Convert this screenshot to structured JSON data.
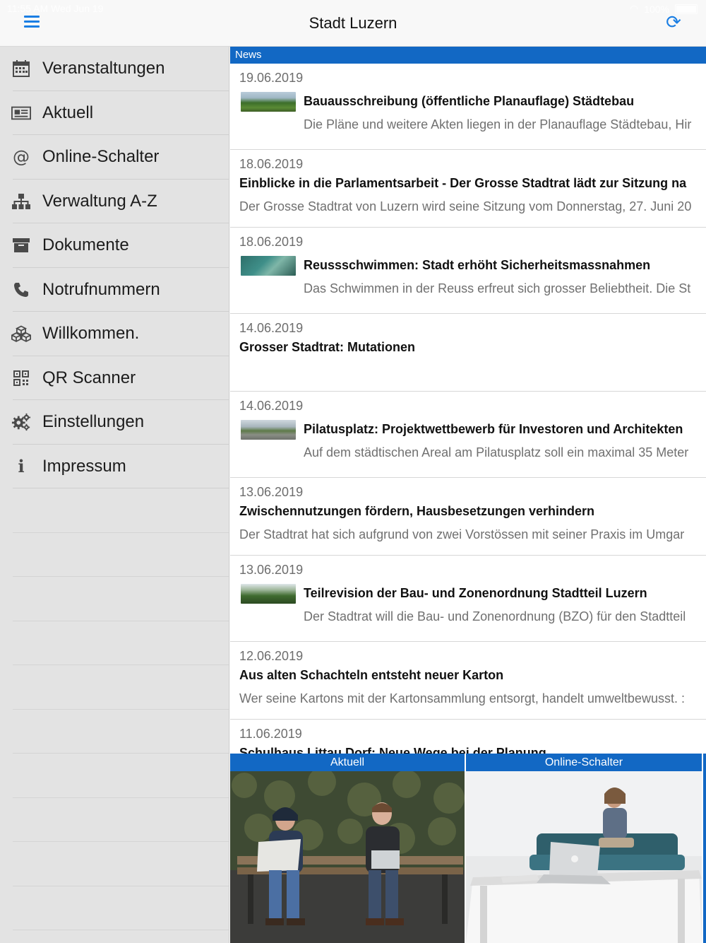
{
  "status_bar": {
    "time": "11:55 AM",
    "date": "Wed Jun 19",
    "battery": "100%"
  },
  "header": {
    "title": "Stadt Luzern"
  },
  "sidebar": {
    "items": [
      {
        "label": "Veranstaltungen",
        "icon": "calendar-icon"
      },
      {
        "label": "Aktuell",
        "icon": "newspaper-icon"
      },
      {
        "label": "Online-Schalter",
        "icon": "at-icon"
      },
      {
        "label": "Verwaltung A-Z",
        "icon": "org-chart-icon"
      },
      {
        "label": "Dokumente",
        "icon": "archive-icon"
      },
      {
        "label": "Notrufnummern",
        "icon": "phone-icon"
      },
      {
        "label": "Willkommen.",
        "icon": "cubes-icon"
      },
      {
        "label": "QR Scanner",
        "icon": "qr-code-icon"
      },
      {
        "label": "Einstellungen",
        "icon": "gears-icon"
      },
      {
        "label": "Impressum",
        "icon": "info-icon"
      }
    ]
  },
  "news": {
    "header": "News",
    "items": [
      {
        "date": "19.06.2019",
        "title": "Bauausschreibung (öffentliche Planauflage) Städtebau",
        "teaser": "Die Pläne und weitere Akten liegen in der Planauflage Städtebau, Hir",
        "has_image": true
      },
      {
        "date": "18.06.2019",
        "title": "Einblicke in die Parlamentsarbeit - Der Grosse Stadtrat lädt zur Sitzung na",
        "teaser": "Der Grosse Stadtrat von Luzern wird seine Sitzung vom Donnerstag, 27. Juni 20",
        "has_image": false
      },
      {
        "date": "18.06.2019",
        "title": "Reussschwimmen: Stadt erhöht Sicherheitsmassnahmen",
        "teaser": "Das Schwimmen in der Reuss erfreut sich grosser Beliebtheit. Die St",
        "has_image": true
      },
      {
        "date": "14.06.2019",
        "title": "Grosser Stadtrat: Mutationen",
        "teaser": "",
        "has_image": false
      },
      {
        "date": "14.06.2019",
        "title": "Pilatusplatz: Projektwettbewerb für Investoren und Architekten",
        "teaser": "Auf dem städtischen Areal am Pilatusplatz soll ein maximal 35 Meter",
        "has_image": true
      },
      {
        "date": "13.06.2019",
        "title": "Zwischennutzungen fördern, Hausbesetzungen verhindern",
        "teaser": "Der Stadtrat hat sich aufgrund von zwei Vorstössen mit seiner Praxis im Umgar",
        "has_image": false
      },
      {
        "date": "13.06.2019",
        "title": "Teilrevision der Bau- und Zonenordnung Stadtteil Luzern",
        "teaser": "Der Stadtrat will die Bau- und Zonenordnung (BZO) für den Stadtteil",
        "has_image": true
      },
      {
        "date": "12.06.2019",
        "title": "Aus alten Schachteln entsteht neuer Karton",
        "teaser": "Wer seine Kartons mit der Kartonsammlung entsorgt, handelt umweltbewusst. :",
        "has_image": false
      },
      {
        "date": "11.06.2019",
        "title": "Schulhaus Littau Dorf: Neue Wege bei der Planung",
        "teaser": "",
        "has_image": false
      }
    ]
  },
  "tiles": [
    {
      "label": "Aktuell"
    },
    {
      "label": "Online-Schalter"
    }
  ],
  "colors": {
    "accent": "#1a7ee3",
    "section_header": "#1268c4",
    "sidebar_bg": "#e3e3e3"
  }
}
